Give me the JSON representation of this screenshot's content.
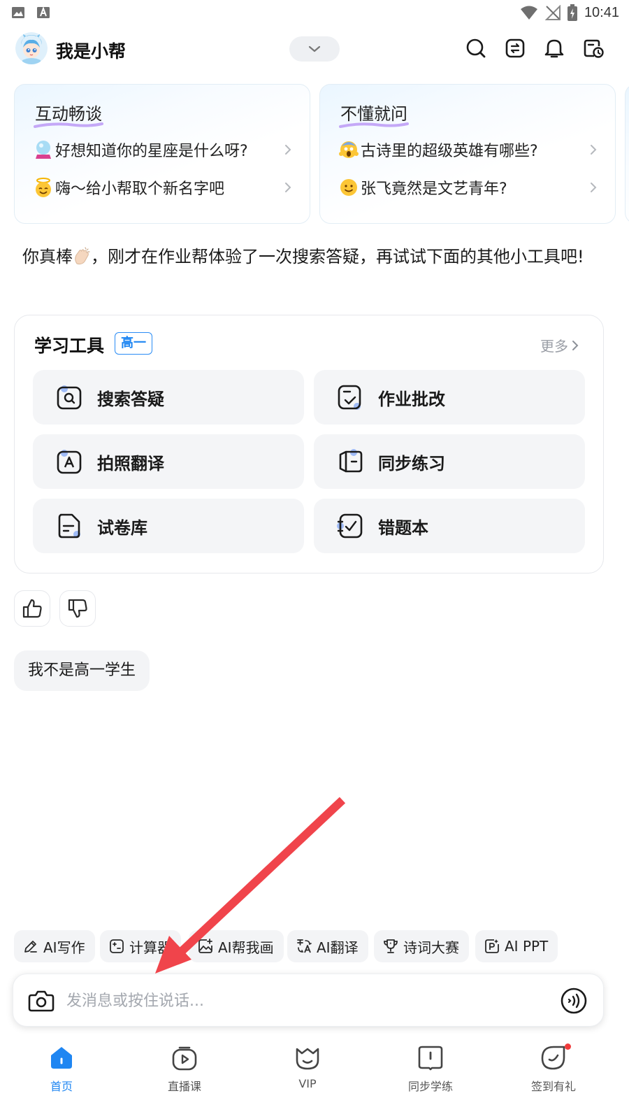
{
  "status_bar": {
    "time": "10:41"
  },
  "header": {
    "title": "我是小帮"
  },
  "topic_cards": [
    {
      "title": "互动畅谈",
      "items": [
        {
          "emoji": "crystal-ball-icon",
          "text": "好想知道你的星座是什么呀?"
        },
        {
          "emoji": "angel-face-icon",
          "text": "嗨～给小帮取个新名字吧"
        }
      ]
    },
    {
      "title": "不懂就问",
      "items": [
        {
          "emoji": "scream-face-icon",
          "text": "古诗里的超级英雄有哪些?"
        },
        {
          "emoji": "smile-face-icon",
          "text": "张飞竟然是文艺青年?"
        }
      ]
    }
  ],
  "message": {
    "part1": "你真棒",
    "part2": "，刚才在作业帮体验了一次搜索答疑，再试试下面的其他小工具吧!"
  },
  "tools": {
    "title": "学习工具",
    "grade": "高一",
    "more": "更多",
    "items": [
      {
        "label": "搜索答疑",
        "icon": "search-answer-icon"
      },
      {
        "label": "作业批改",
        "icon": "homework-check-icon"
      },
      {
        "label": "拍照翻译",
        "icon": "photo-translate-icon"
      },
      {
        "label": "同步练习",
        "icon": "sync-practice-icon"
      },
      {
        "label": "试卷库",
        "icon": "exam-library-icon"
      },
      {
        "label": "错题本",
        "icon": "mistake-book-icon"
      }
    ]
  },
  "quick_reply": "我不是高一学生",
  "quick_tools": [
    {
      "label": "AI写作",
      "icon": "pen-icon"
    },
    {
      "label": "计算器",
      "icon": "calculator-icon"
    },
    {
      "label": "AI帮我画",
      "icon": "image-plus-icon"
    },
    {
      "label": "AI翻译",
      "icon": "translate-icon"
    },
    {
      "label": "诗词大赛",
      "icon": "trophy-icon"
    },
    {
      "label": "AI PPT",
      "icon": "ppt-icon"
    }
  ],
  "input": {
    "placeholder": "发消息或按住说话..."
  },
  "bottom_nav": [
    {
      "label": "首页",
      "icon": "home-icon",
      "active": true
    },
    {
      "label": "直播课",
      "icon": "live-class-icon",
      "active": false
    },
    {
      "label": "VIP",
      "icon": "vip-icon",
      "active": false
    },
    {
      "label": "同步学练",
      "icon": "sync-study-icon",
      "active": false
    },
    {
      "label": "签到有礼",
      "icon": "checkin-gift-icon",
      "active": false
    }
  ],
  "colors": {
    "accent": "#1f86f2",
    "annotation_arrow": "#f0444b",
    "notification_dot": "#f03b3b"
  }
}
